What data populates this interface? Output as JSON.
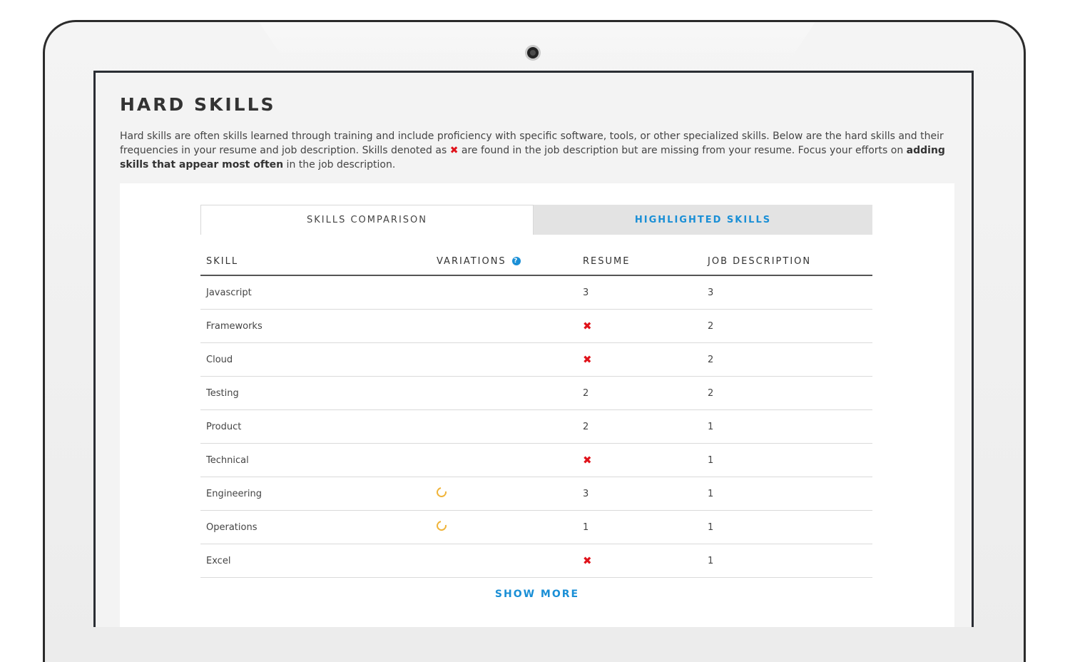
{
  "section": {
    "title": "HARD SKILLS",
    "desc_part1": "Hard skills are often skills learned through training and include proficiency with specific software, tools, or other specialized skills. Below are the hard skills and their frequencies in your resume and job description. Skills denoted as ",
    "desc_mark": "✖",
    "desc_part2": " are found in the job description but are missing from your resume. Focus your efforts on ",
    "desc_bold1": "adding skills that appear most often",
    "desc_part3": " in the job description."
  },
  "tabs": {
    "comparison": "SKILLS COMPARISON",
    "highlighted": "HIGHLIGHTED SKILLS"
  },
  "table": {
    "headers": {
      "skill": "SKILL",
      "variations": "VARIATIONS",
      "resume": "RESUME",
      "job": "JOB DESCRIPTION"
    },
    "help_icon": "?",
    "missing_mark": "✖",
    "rows": [
      {
        "skill": "Javascript",
        "variation": false,
        "resume": "3",
        "job": "3"
      },
      {
        "skill": "Frameworks",
        "variation": false,
        "resume": "",
        "job": "2"
      },
      {
        "skill": "Cloud",
        "variation": false,
        "resume": "",
        "job": "2"
      },
      {
        "skill": "Testing",
        "variation": false,
        "resume": "2",
        "job": "2"
      },
      {
        "skill": "Product",
        "variation": false,
        "resume": "2",
        "job": "1"
      },
      {
        "skill": "Technical",
        "variation": false,
        "resume": "",
        "job": "1"
      },
      {
        "skill": "Engineering",
        "variation": true,
        "resume": "3",
        "job": "1"
      },
      {
        "skill": "Operations",
        "variation": true,
        "resume": "1",
        "job": "1"
      },
      {
        "skill": "Excel",
        "variation": false,
        "resume": "",
        "job": "1"
      }
    ]
  },
  "show_more": "SHOW MORE",
  "colors": {
    "accent": "#1a8fd6",
    "missing": "#e0131b",
    "variation": "#f0b43a"
  }
}
